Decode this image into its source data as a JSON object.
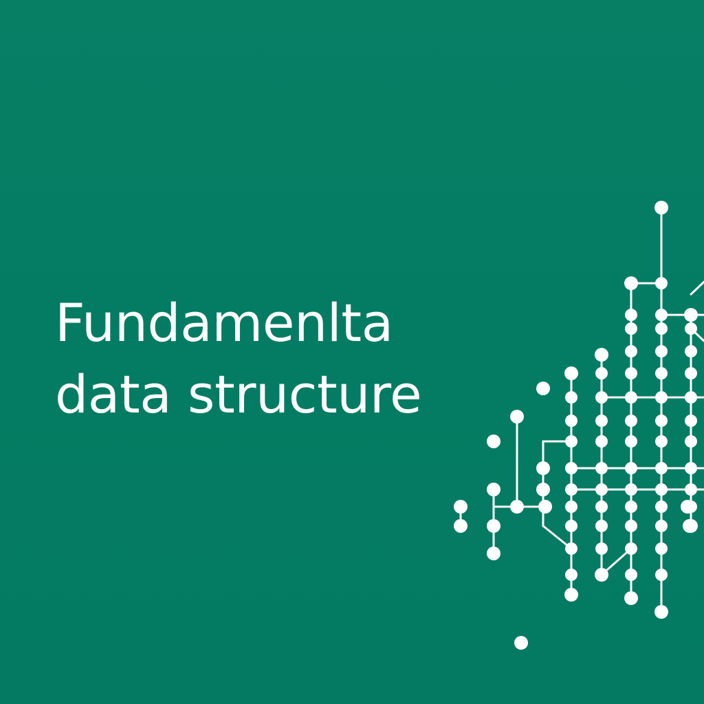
{
  "title": {
    "line1": "Fundamenlta",
    "line2": "data structure"
  },
  "colors": {
    "background": "#047d63",
    "foreground": "#ffffff"
  },
  "graphic": {
    "name": "node-network-illustration"
  }
}
